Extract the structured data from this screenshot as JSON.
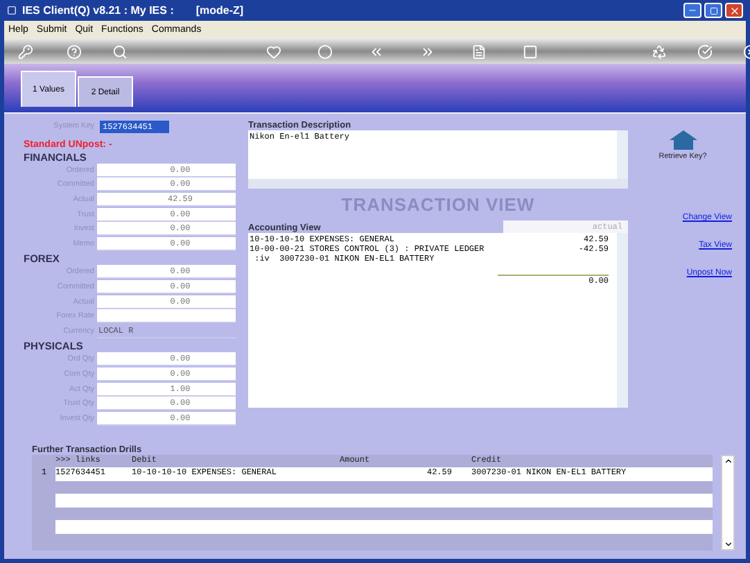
{
  "window": {
    "title": "IES Client(Q) v8.21 : My IES :",
    "mode": "[mode-Z]"
  },
  "menu": [
    "Help",
    "Submit",
    "Quit",
    "Functions",
    "Commands"
  ],
  "tabs": [
    {
      "label": "1 Values",
      "selected": true
    },
    {
      "label": "2 Detail",
      "selected": false
    }
  ],
  "system_key": {
    "label": "System Key",
    "value": "1527634451"
  },
  "status_title": "Standard UNpost: -",
  "sections": [
    {
      "title": "FINANCIALS",
      "fields": [
        {
          "label": "Ordered",
          "value": "0.00"
        },
        {
          "label": "Committed",
          "value": "0.00"
        },
        {
          "label": "Actual",
          "value": "42.59"
        },
        {
          "label": "Trust",
          "value": "0.00"
        },
        {
          "label": "Invest",
          "value": "0.00"
        },
        {
          "label": "Memo",
          "value": "0.00"
        }
      ]
    },
    {
      "title": "FOREX",
      "fields": [
        {
          "label": "Ordered",
          "value": "0.00"
        },
        {
          "label": "Committed",
          "value": "0.00"
        },
        {
          "label": "Actual",
          "value": "0.00"
        },
        {
          "label": "Forex Rate",
          "kind": "number"
        },
        {
          "label": "Currency",
          "value": "LOCAL R",
          "kind": "text"
        }
      ]
    },
    {
      "title": "PHYSICALS",
      "fields": [
        {
          "label": "Ord Qty",
          "value": "0.00"
        },
        {
          "label": "Com Qty",
          "value": "0.00"
        },
        {
          "label": "Act Qty",
          "value": "1.00"
        },
        {
          "label": "Trust Qty",
          "value": "0.00"
        },
        {
          "label": "Invest Qty",
          "value": "0.00"
        }
      ]
    }
  ],
  "transaction_description": {
    "label": "Transaction Description",
    "text": "Nikon En-el1 Battery"
  },
  "view_title": "TRANSACTION VIEW",
  "accounting_view": {
    "label": "Accounting View",
    "mode": "actual",
    "lines": [
      {
        "text": "10-10-10-10 EXPENSES: GENERAL",
        "amount": "42.59"
      },
      {
        "text": "10-00-00-21 STORES CONTROL (3) : PRIVATE LEDGER",
        "amount": "-42.59"
      },
      {
        "text": " :iv  3007230-01 NIKON EN-EL1 BATTERY"
      }
    ],
    "total": "0.00"
  },
  "retrieve_key": "Retrieve Key?",
  "links": [
    "Change View",
    "Tax View",
    "Unpost Now"
  ],
  "drills": {
    "title": "Further Transaction Drills",
    "columns": [
      ">>> links",
      "Debit",
      "Amount",
      "Credit"
    ],
    "rows": [
      {
        "index": "1",
        "cells": [
          "1527634451",
          "10-10-10-10 EXPENSES: GENERAL",
          "42.59",
          "3007230-01 NIKON EN-EL1 BATTERY"
        ]
      }
    ]
  }
}
